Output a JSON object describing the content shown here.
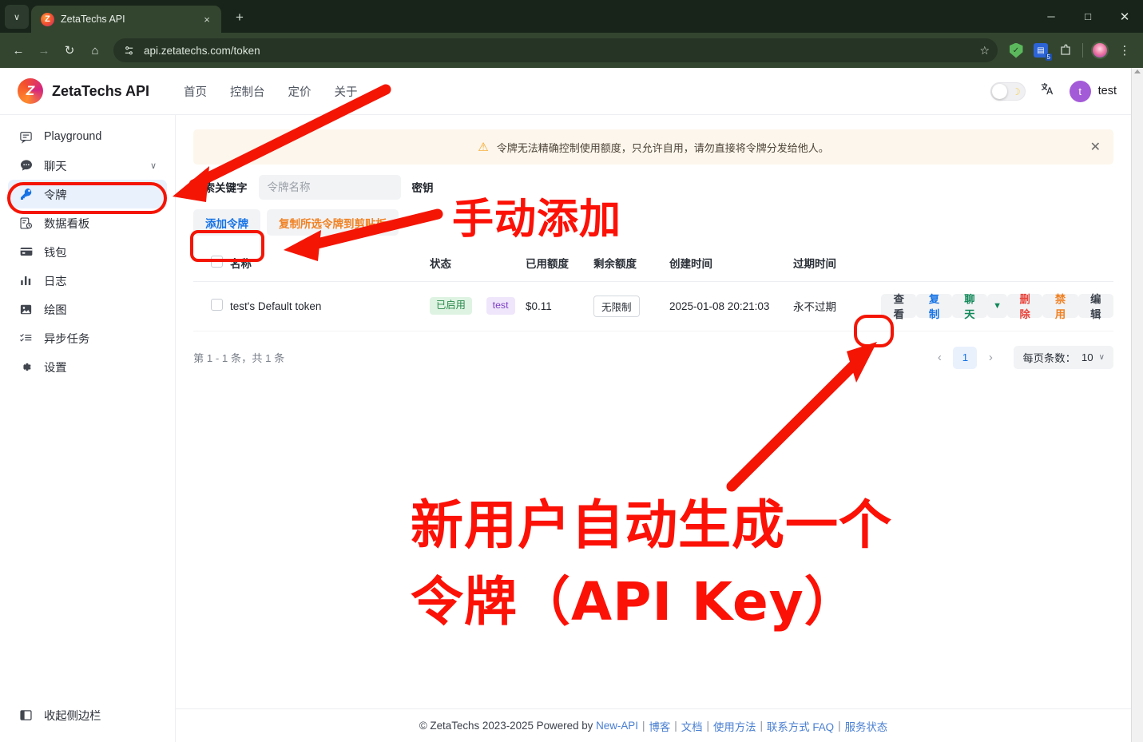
{
  "browser": {
    "tab_title": "ZetaTechs API",
    "tab_favicon_letter": "Z",
    "url": "api.zetatechs.com/token",
    "new_tab_label": "+",
    "tab_close_label": "×",
    "tab_menu_label": "∨",
    "nav": {
      "back": "←",
      "forward": "→",
      "reload": "↻",
      "home": "⌂"
    },
    "site_info_icon": "tune-icon",
    "bookmark_star": "☆",
    "ext_badge_count": "5",
    "window": {
      "minimize": "─",
      "maximize": "□",
      "close": "✕"
    },
    "menu_dots": "⋮"
  },
  "topnav": {
    "brand": "ZetaTechs API",
    "logo_letter": "Z",
    "links": [
      {
        "label": "首页"
      },
      {
        "label": "控制台"
      },
      {
        "label": "定价"
      },
      {
        "label": "关于"
      }
    ],
    "theme_toggle_icon": "☽",
    "translate_icon": "文A",
    "user": {
      "avatar_letter": "t",
      "name": "test"
    }
  },
  "sidebar": {
    "items": [
      {
        "label": "Playground",
        "icon": "chat-bubble-square-icon",
        "active": false,
        "chevron": ""
      },
      {
        "label": "聊天",
        "icon": "chat-dots-icon",
        "active": false,
        "chevron": "∨"
      },
      {
        "label": "令牌",
        "icon": "key-icon",
        "active": true,
        "chevron": ""
      },
      {
        "label": "数据看板",
        "icon": "dashboard-clock-icon",
        "active": false,
        "chevron": ""
      },
      {
        "label": "钱包",
        "icon": "wallet-card-icon",
        "active": false,
        "chevron": ""
      },
      {
        "label": "日志",
        "icon": "bar-chart-icon",
        "active": false,
        "chevron": ""
      },
      {
        "label": "绘图",
        "icon": "image-icon",
        "active": false,
        "chevron": ""
      },
      {
        "label": "异步任务",
        "icon": "checklist-icon",
        "active": false,
        "chevron": ""
      },
      {
        "label": "设置",
        "icon": "gear-icon",
        "active": false,
        "chevron": ""
      }
    ],
    "collapse": {
      "label": "收起侧边栏",
      "icon": "sidebar-collapse-icon"
    }
  },
  "alert": {
    "icon": "warning-triangle-icon",
    "text": "令牌无法精确控制使用额度，只允许自用，请勿直接将令牌分发给他人。",
    "close": "✕"
  },
  "search": {
    "label": "搜索关键字",
    "placeholder": "令牌名称",
    "value": "",
    "key_label": "密钥"
  },
  "toolbar": {
    "add_token_label": "添加令牌",
    "copy_selected_label": "复制所选令牌到剪贴板"
  },
  "table": {
    "columns": [
      "名称",
      "状态",
      "已用额度",
      "剩余额度",
      "创建时间",
      "过期时间",
      ""
    ],
    "rows": [
      {
        "name": "test's Default token",
        "status": "已启用",
        "group": "test",
        "used_quota": "$0.11",
        "remain_quota": "无限制",
        "created_at": "2025-01-08 20:21:03",
        "expires_at": "永不过期",
        "actions": [
          {
            "label": "查看",
            "color": "gray"
          },
          {
            "label": "复制",
            "color": "blue"
          },
          {
            "label": "聊天",
            "color": "green"
          },
          {
            "label": "▼",
            "color": "caret"
          },
          {
            "label": "删除",
            "color": "red"
          },
          {
            "label": "禁用",
            "color": "orange"
          },
          {
            "label": "编辑",
            "color": "gray"
          }
        ]
      }
    ]
  },
  "pagination": {
    "info": "第 1 - 1 条，共 1 条",
    "prev": "‹",
    "next": "›",
    "current_page": "1",
    "page_size_label": "每页条数：",
    "page_size_value": "10",
    "page_size_caret": "∨"
  },
  "footer": {
    "copyright": "© ZetaTechs 2023-2025 Powered by",
    "powered_link": "New-API",
    "links": [
      {
        "label": "博客"
      },
      {
        "label": "文档"
      },
      {
        "label": "使用方法"
      },
      {
        "label": "联系方式 FAQ"
      },
      {
        "label": "服务状态"
      }
    ],
    "separator": "|"
  },
  "annotations": {
    "accent_color": "#fc1107",
    "manual_add_text": "手动添加",
    "auto_gen_line1": "新用户自动生成一个",
    "auto_gen_line2": "令牌（API Key）"
  }
}
